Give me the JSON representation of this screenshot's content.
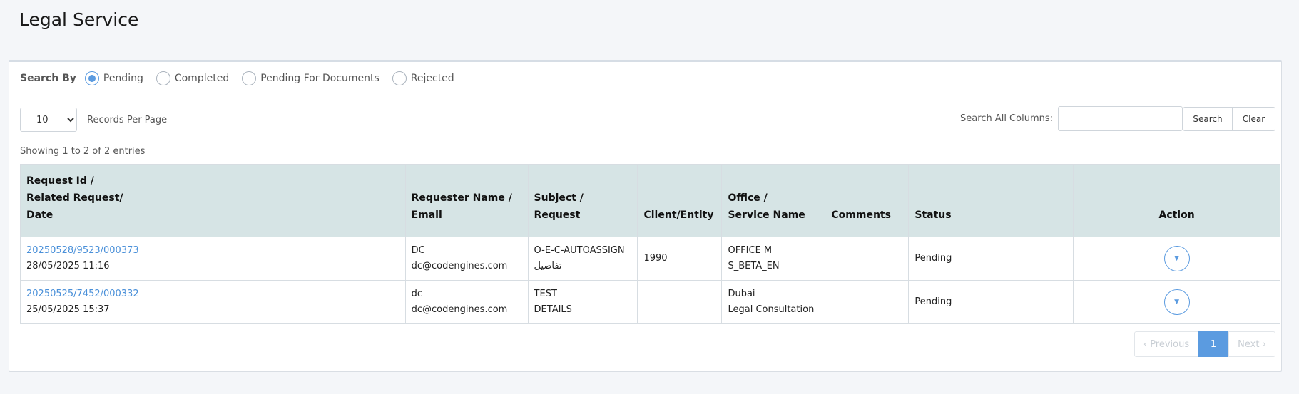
{
  "page": {
    "title": "Legal Service"
  },
  "filters": {
    "label": "Search By",
    "options": [
      {
        "label": "Pending",
        "checked": true
      },
      {
        "label": "Completed",
        "checked": false
      },
      {
        "label": "Pending For Documents",
        "checked": false
      },
      {
        "label": "Rejected",
        "checked": false
      }
    ]
  },
  "toolbar": {
    "records_value": "10",
    "records_label": "Records Per Page",
    "search_label": "Search All Columns:",
    "search_value": "",
    "search_button": "Search",
    "clear_button": "Clear"
  },
  "showing": "Showing 1 to 2 of 2 entries",
  "table": {
    "headers": {
      "request": [
        "Request Id /",
        "Related Request/",
        "Date"
      ],
      "requester": [
        "Requester Name /",
        "Email"
      ],
      "subject": [
        "Subject /",
        "Request"
      ],
      "client": "Client/Entity",
      "office": [
        "Office /",
        "Service Name"
      ],
      "comments": "Comments",
      "status": "Status",
      "action": "Action"
    },
    "rows": [
      {
        "request_id": "20250528/9523/000373",
        "date": "28/05/2025 11:16",
        "requester_name": "DC",
        "email": "dc@codengines.com",
        "subject": "O-E-C-AUTOASSIGN",
        "request": "تفاصيل",
        "client": "1990",
        "office": "OFFICE M",
        "service": "S_BETA_EN",
        "comments": "",
        "status": "Pending"
      },
      {
        "request_id": "20250525/7452/000332",
        "date": "25/05/2025 15:37",
        "requester_name": "dc",
        "email": "dc@codengines.com",
        "subject": "TEST",
        "request": "DETAILS",
        "client": "",
        "office": "Dubai",
        "service": "Legal Consultation",
        "comments": "",
        "status": "Pending"
      }
    ]
  },
  "pagination": {
    "previous": "Previous",
    "current": "1",
    "next": "Next"
  },
  "icons": {
    "action": "caret-down-icon",
    "previous": "chevron-left-icon",
    "next": "chevron-right-icon"
  },
  "colors": {
    "accent": "#5b9be0",
    "link": "#4a90d9",
    "header_bg": "#d6e4e5"
  }
}
